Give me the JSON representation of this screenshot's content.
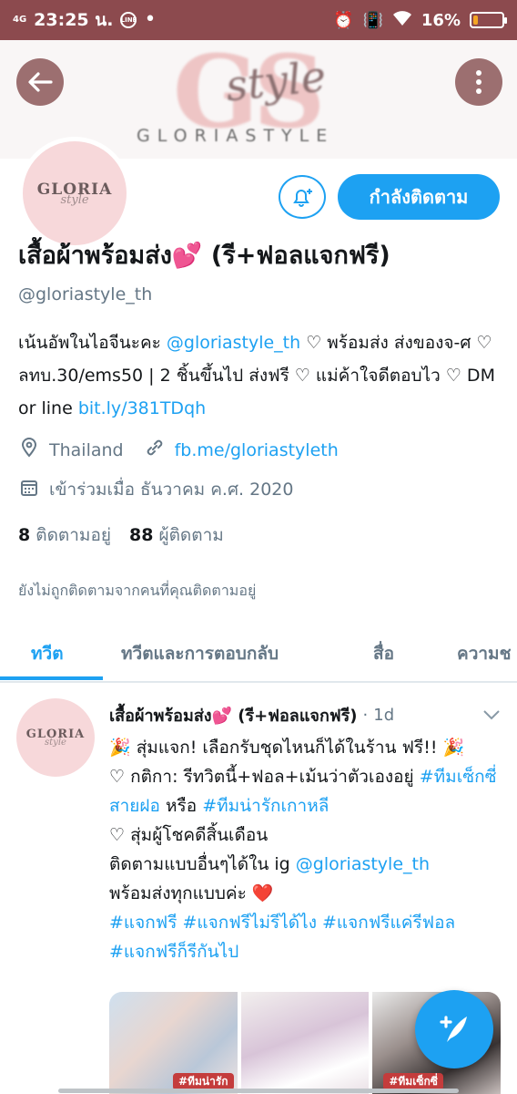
{
  "statusbar": {
    "network": "4G",
    "time": "23:25 น.",
    "line_badge": "LINE",
    "battery_pct": "16%",
    "battery_level": 0.16,
    "icons": [
      "line-app-icon",
      "dot-icon",
      "alarm-icon",
      "vibrate-icon",
      "wifi-icon",
      "battery-icon"
    ]
  },
  "banner": {
    "logo_letters": "GS",
    "logo_script": "style",
    "brand_text": "GLORIASTYLE"
  },
  "avatar": {
    "line1": "GLORIA",
    "line2": "style"
  },
  "actions": {
    "follow_label": "กำลังติดตาม",
    "bell_icon": "bell-plus-icon"
  },
  "profile": {
    "display_name": "เสื้อผ้าพร้อมส่ง💕 (รี+ฟอลแจกฟรี)",
    "handle": "@gloriastyle_th",
    "bio_part1": "เน้นอัพในไอจีนะคะ ",
    "bio_mention": "@gloriastyle_th",
    "bio_part2": " ♡ พร้อมส่ง ส่งของจ-ศ ♡ ลทบ.30/ems50 | 2 ชิ้นขึ้นไป ส่งฟรี ♡ แม่ค้าใจดีตอบไว ♡ DM or line ",
    "bio_link": "bit.ly/381TDqh",
    "location": "Thailand",
    "website": "fb.me/gloriastyleth",
    "joined": "เข้าร่วมเมื่อ ธันวาคม ค.ศ. 2020",
    "following_count": "8",
    "following_label": "ติดตามอยู่",
    "followers_count": "88",
    "followers_label": "ผู้ติดตาม",
    "not_followed_note": "ยังไม่ถูกติดตามจากคนที่คุณติดตามอยู่"
  },
  "tabs": [
    {
      "label": "ทวีต",
      "active": true
    },
    {
      "label": "ทวีตและการตอบกลับ",
      "active": false
    },
    {
      "label": "สื่อ",
      "active": false
    },
    {
      "label": "ความช",
      "active": false
    }
  ],
  "tweet": {
    "author": "เสื้อผ้าพร้อมส่ง💕 (รี+ฟอลแจกฟรี)",
    "separator": "·",
    "time": "1d",
    "line1": "🎉 สุ่มแจก! เลือกรับชุดไหนก็ได้ในร้าน ฟรี!! 🎉",
    "line2_pre": "♡ กติกา: รีทวิตนี้+ฟอล+เม้นว่าตัวเองอยู่ ",
    "line2_tag1": "#ทีมเซ็กซี่สายฝอ",
    "line2_mid": " หรือ ",
    "line2_tag2": "#ทีมน่ารักเกาหลี",
    "line3": "♡ สุ่มผู้โชคดีสิ้นเดือน",
    "line4_pre": "ติดตามแบบอื่นๆได้ใน ig ",
    "line4_mention": "@gloriastyle_th",
    "line5": "พร้อมส่งทุกแบบค่ะ ",
    "heart": "❤️",
    "hashtags_line1": "#แจกฟรี #แจกฟรีไม่รีได้ไง #แจกฟรีแค่รีฟอล",
    "hashtags_line2": "#แจกฟรีก็รีกันไป",
    "media_label1": "#ทีมน่ารัก",
    "media_label2": "#ทีมเซ็กซี่"
  },
  "fab": {
    "icon": "compose-tweet-icon",
    "glyph": "+"
  }
}
